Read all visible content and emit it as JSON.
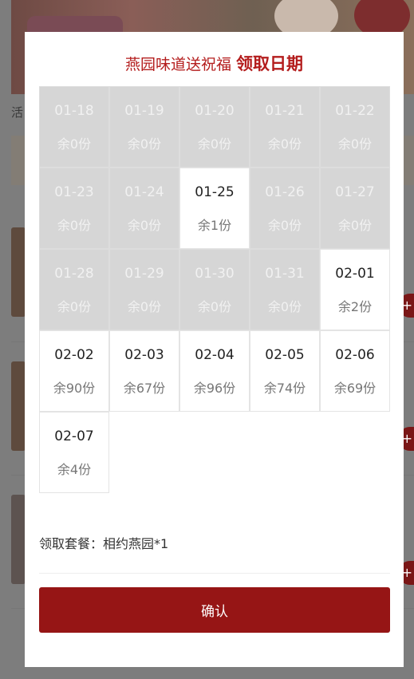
{
  "background": {
    "title_fragment": "活"
  },
  "modal": {
    "title_main": "燕园味道送祝福",
    "title_emph": "领取日期",
    "dates": [
      {
        "date": "01-18",
        "left": "余0份",
        "available": false
      },
      {
        "date": "01-19",
        "left": "余0份",
        "available": false
      },
      {
        "date": "01-20",
        "left": "余0份",
        "available": false
      },
      {
        "date": "01-21",
        "left": "余0份",
        "available": false
      },
      {
        "date": "01-22",
        "left": "余0份",
        "available": false
      },
      {
        "date": "01-23",
        "left": "余0份",
        "available": false
      },
      {
        "date": "01-24",
        "left": "余0份",
        "available": false
      },
      {
        "date": "01-25",
        "left": "余1份",
        "available": true
      },
      {
        "date": "01-26",
        "left": "余0份",
        "available": false
      },
      {
        "date": "01-27",
        "left": "余0份",
        "available": false
      },
      {
        "date": "01-28",
        "left": "余0份",
        "available": false
      },
      {
        "date": "01-29",
        "left": "余0份",
        "available": false
      },
      {
        "date": "01-30",
        "left": "余0份",
        "available": false
      },
      {
        "date": "01-31",
        "left": "余0份",
        "available": false
      },
      {
        "date": "02-01",
        "left": "余2份",
        "available": true
      },
      {
        "date": "02-02",
        "left": "余90份",
        "available": true
      },
      {
        "date": "02-03",
        "left": "余67份",
        "available": true
      },
      {
        "date": "02-04",
        "left": "余96份",
        "available": true
      },
      {
        "date": "02-05",
        "left": "余74份",
        "available": true
      },
      {
        "date": "02-06",
        "left": "余69份",
        "available": true
      },
      {
        "date": "02-07",
        "left": "余4份",
        "available": true
      }
    ],
    "package_text": "领取套餐：相约燕园*1",
    "confirm_label": "确认"
  },
  "colors": {
    "accent": "#961515",
    "title_red": "#b41d1d",
    "disabled_cell": "#d6d6d6"
  }
}
